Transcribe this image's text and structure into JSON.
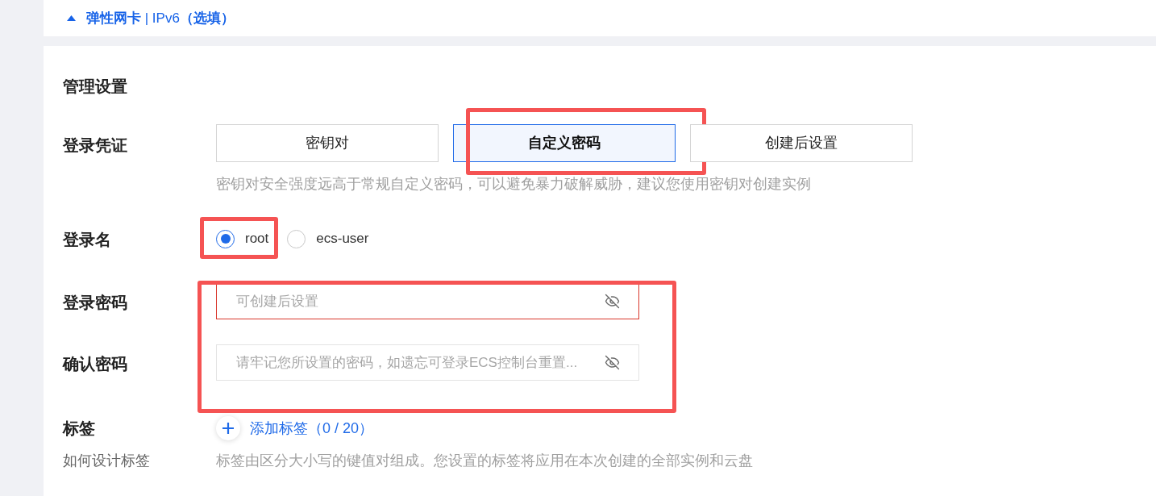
{
  "section_header": {
    "title": "**弹性网卡** | IPv6**（选填）**",
    "expanded": true
  },
  "management": {
    "title": "管理设置",
    "credential": {
      "label": "登录凭证",
      "options": [
        {
          "label": "密钥对",
          "selected": false,
          "highlighted": false
        },
        {
          "label": "自定义密码",
          "selected": true,
          "highlighted": true
        },
        {
          "label": "创建后设置",
          "selected": false,
          "highlighted": false
        }
      ],
      "hint": "密钥对安全强度远高于常规自定义密码，可以避免暴力破解威胁，建议您使用密钥对创建实例"
    },
    "login_name": {
      "label": "登录名",
      "options": [
        {
          "label": "root",
          "selected": true,
          "highlighted": true
        },
        {
          "label": "ecs-user",
          "selected": false,
          "highlighted": false
        }
      ]
    },
    "passwords": {
      "highlighted": true,
      "fields": [
        {
          "label": "登录密码",
          "placeholder": "可创建后设置",
          "error": true
        },
        {
          "label": "确认密码",
          "placeholder": "请牢记您所设置的密码，如遗忘可登录ECS控制台重置...",
          "error": false
        }
      ]
    },
    "tags": {
      "label": "标签",
      "add_label": "添加标签（0 / 20）",
      "help_link": "如何设计标签",
      "hint": "标签由区分大小写的键值对组成。您设置的标签将应用在本次创建的全部实例和云盘"
    }
  }
}
